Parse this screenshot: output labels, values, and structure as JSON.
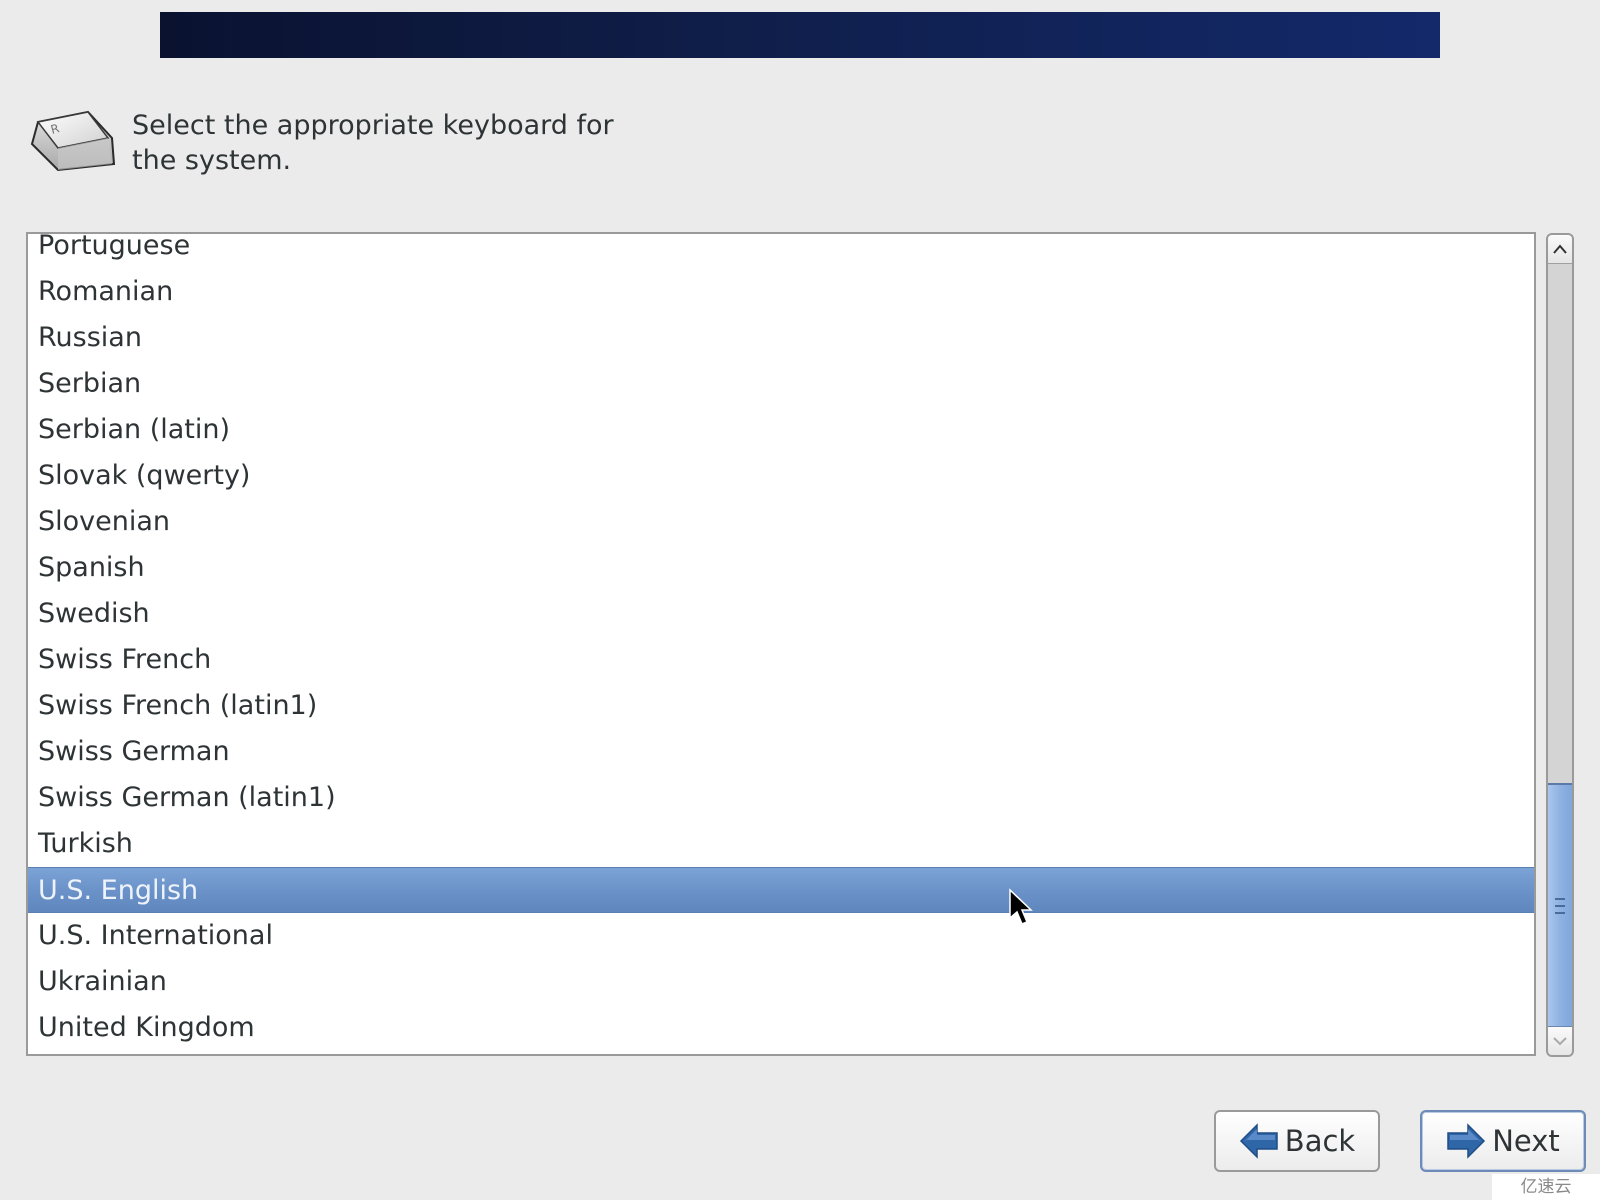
{
  "banner": {
    "color_start": "#0a1230",
    "color_end": "#13296a"
  },
  "header": {
    "icon": "keyboard-key-icon",
    "prompt": "Select the appropriate keyboard for the system."
  },
  "keyboard_list": {
    "items": [
      "Portuguese",
      "Romanian",
      "Russian",
      "Serbian",
      "Serbian (latin)",
      "Slovak (qwerty)",
      "Slovenian",
      "Spanish",
      "Swedish",
      "Swiss French",
      "Swiss French (latin1)",
      "Swiss German",
      "Swiss German (latin1)",
      "Turkish",
      "U.S. English",
      "U.S. International",
      "Ukrainian",
      "United Kingdom"
    ],
    "selected": "U.S. English",
    "selection_color": "#6b93c9",
    "scroll_position_fraction": 1.0,
    "visible_fraction": 0.32
  },
  "buttons": {
    "back_label": "Back",
    "next_label": "Next",
    "arrow_color": "#2f66a8"
  },
  "watermark": {
    "text": "亿速云"
  }
}
